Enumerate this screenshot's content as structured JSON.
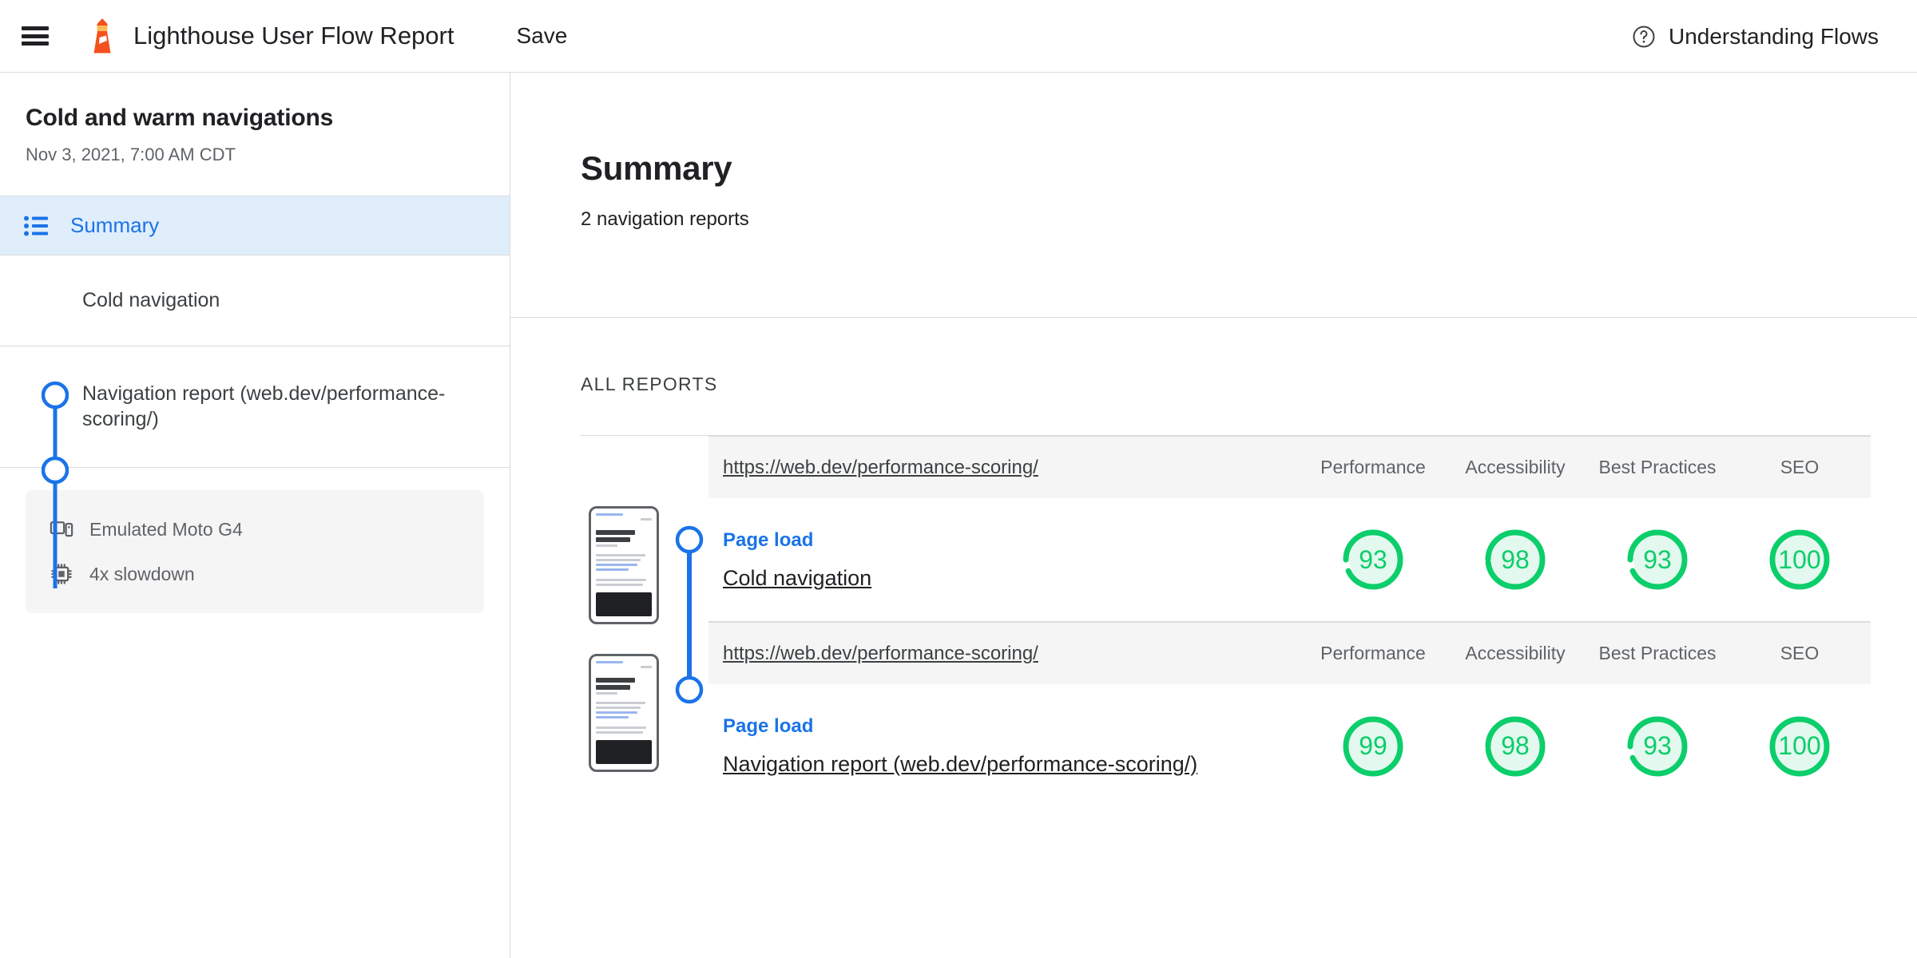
{
  "topbar": {
    "menu_icon": "hamburger-icon",
    "logo_icon": "lighthouse-logo-icon",
    "title": "Lighthouse User Flow Report",
    "save_label": "Save",
    "help_icon": "help-circle-icon",
    "understanding_label": "Understanding Flows"
  },
  "sidebar": {
    "flow_title": "Cold and warm navigations",
    "flow_date": "Nov 3, 2021, 7:00 AM CDT",
    "summary_item": {
      "icon": "list-icon",
      "label": "Summary"
    },
    "steps": [
      {
        "label": "Cold navigation"
      },
      {
        "label": "Navigation report (web.dev/performance-scoring/)"
      }
    ],
    "device": {
      "rows": [
        {
          "icon": "device-phone-icon",
          "text": "Emulated Moto G4"
        },
        {
          "icon": "cpu-chip-icon",
          "text": "4x slowdown"
        }
      ]
    }
  },
  "main": {
    "summary_title": "Summary",
    "summary_subtitle": "2 navigation reports",
    "all_reports_label": "ALL REPORTS",
    "categories": [
      "Performance",
      "Accessibility",
      "Best Practices",
      "SEO"
    ],
    "reports": [
      {
        "url": "https://web.dev/performance-scoring/",
        "kind": "Page load",
        "name": "Cold navigation",
        "thumbnail": "page-screenshot-thumbnail",
        "scores": [
          93,
          98,
          93,
          100
        ]
      },
      {
        "url": "https://web.dev/performance-scoring/",
        "kind": "Page load",
        "name": "Navigation report (web.dev/performance-scoring/)",
        "thumbnail": "page-screenshot-thumbnail",
        "scores": [
          99,
          98,
          93,
          100
        ]
      }
    ]
  },
  "colors": {
    "accent_blue": "#1a73e8",
    "score_green": "#0cce6b",
    "score_green_bg": "#e3f8ee",
    "logo_orange": "#f4511e",
    "divider": "#dadce0",
    "selected_bg": "#e0eefc"
  }
}
